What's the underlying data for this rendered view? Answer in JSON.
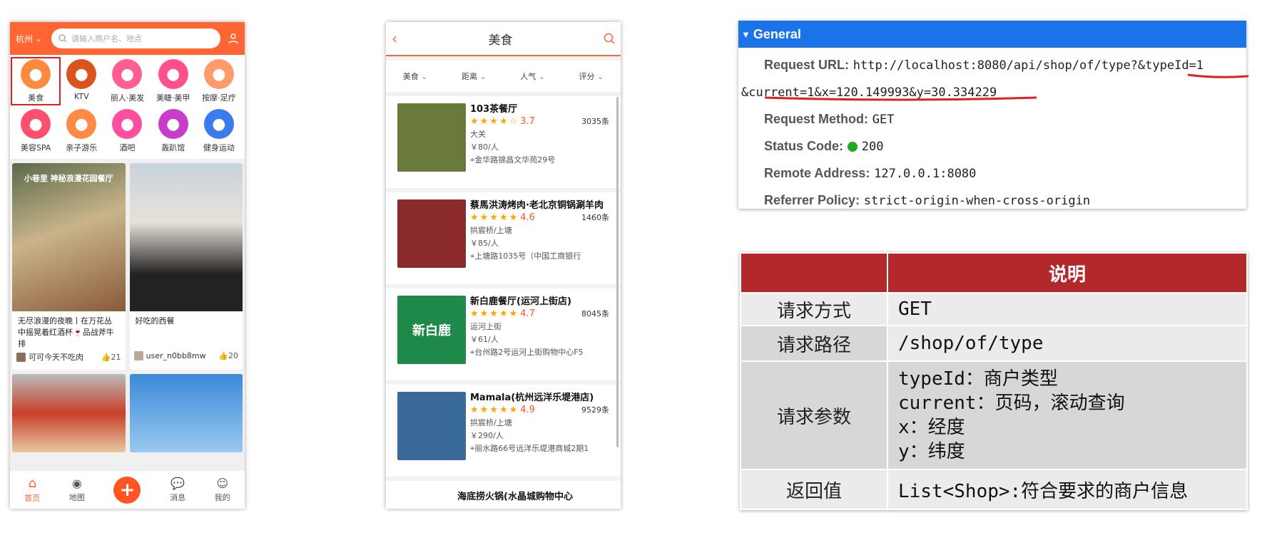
{
  "home": {
    "city": "杭州",
    "search_placeholder": "请输入商户名、地点",
    "categories": [
      {
        "label": "美食",
        "icon": "food-icon",
        "color": "#ff8a3d"
      },
      {
        "label": "KTV",
        "icon": "microphone-icon",
        "color": "#d9541e"
      },
      {
        "label": "丽人·美发",
        "icon": "hair-icon",
        "color": "#ff5f8f"
      },
      {
        "label": "美睫·美甲",
        "icon": "nail-icon",
        "color": "#ff4f8c"
      },
      {
        "label": "按摩·足疗",
        "icon": "massage-icon",
        "color": "#ff9a6a"
      },
      {
        "label": "美容SPA",
        "icon": "spa-icon",
        "color": "#ff4f6f"
      },
      {
        "label": "亲子游乐",
        "icon": "family-icon",
        "color": "#ff8a45"
      },
      {
        "label": "酒吧",
        "icon": "cocktail-icon",
        "color": "#ff4fa0"
      },
      {
        "label": "轰趴馆",
        "icon": "mask-icon",
        "color": "#c83cc8"
      },
      {
        "label": "健身运动",
        "icon": "dumbbell-icon",
        "color": "#3a7cf0"
      }
    ],
    "posts": [
      {
        "overlay": "小巷里 神秘浪漫花园餐厅",
        "text": "无尽浪漫的夜晚丨在万花丛中摇晃着红酒杯🍷品战斧牛排",
        "author": "可可今天不吃肉",
        "likes": "21"
      },
      {
        "overlay": "",
        "text": "好吃的西餐",
        "author": "user_n0bb8mw",
        "likes": "20"
      }
    ],
    "tabs": [
      "首页",
      "地图",
      "消息",
      "我的"
    ]
  },
  "food": {
    "title": "美食",
    "filters": [
      "美食",
      "距离",
      "人气",
      "评分"
    ],
    "shops": [
      {
        "name": "103茶餐厅",
        "stars": "★★★★☆",
        "score": "3.7",
        "count": "3035条",
        "area": "大关",
        "price": "￥80/人",
        "address": "金华路锦昌文华苑29号",
        "color": "#6a7a3a"
      },
      {
        "name": "蔡馬洪涛烤肉·老北京铜锅涮羊肉",
        "stars": "★★★★★",
        "score": "4.6",
        "count": "1460条",
        "area": "拱宸桥/上塘",
        "price": "￥85/人",
        "address": "上塘路1035号（中国工商银行",
        "color": "#8a2a2a"
      },
      {
        "name": "新白鹿餐厅(运河上街店)",
        "stars": "★★★★★",
        "score": "4.7",
        "count": "8045条",
        "area": "运河上街",
        "price": "￥61/人",
        "address": "台州路2号运河上街购物中心F5",
        "color": "#1e8a4a",
        "logo": "新白鹿"
      },
      {
        "name": "Mamala(杭州远洋乐堤港店)",
        "stars": "★★★★★",
        "score": "4.9",
        "count": "9529条",
        "area": "拱宸桥/上塘",
        "price": "￥290/人",
        "address": "丽水路66号远洋乐堤港商城2期1",
        "color": "#3a6a9a"
      },
      {
        "name": "海底捞火锅(水晶城购物中心",
        "stars": "",
        "score": "",
        "count": "",
        "area": "",
        "price": "",
        "address": "",
        "color": "#ffffff"
      }
    ]
  },
  "request": {
    "section": "General",
    "rows": [
      {
        "label": "Request URL:",
        "value": "http://localhost:8080/api/shop/of/type?&typeId=1"
      },
      {
        "label": "",
        "value": "&current=1&x=120.149993&y=30.334229"
      },
      {
        "label": "Request Method:",
        "value": "GET"
      },
      {
        "label": "Status Code:",
        "value": "200"
      },
      {
        "label": "Remote Address:",
        "value": "127.0.0.1:8080"
      },
      {
        "label": "Referrer Policy:",
        "value": "strict-origin-when-cross-origin"
      }
    ]
  },
  "doc": {
    "header": "说明",
    "rows": [
      {
        "key": "请求方式",
        "value": "GET"
      },
      {
        "key": "请求路径",
        "value": "/shop/of/type"
      },
      {
        "key": "请求参数",
        "lines": [
          "typeId：商户类型",
          "current：页码，滚动查询",
          "x：经度",
          "y：纬度"
        ]
      },
      {
        "key": "返回值",
        "value": "List<Shop>:符合要求的商户信息"
      }
    ]
  }
}
